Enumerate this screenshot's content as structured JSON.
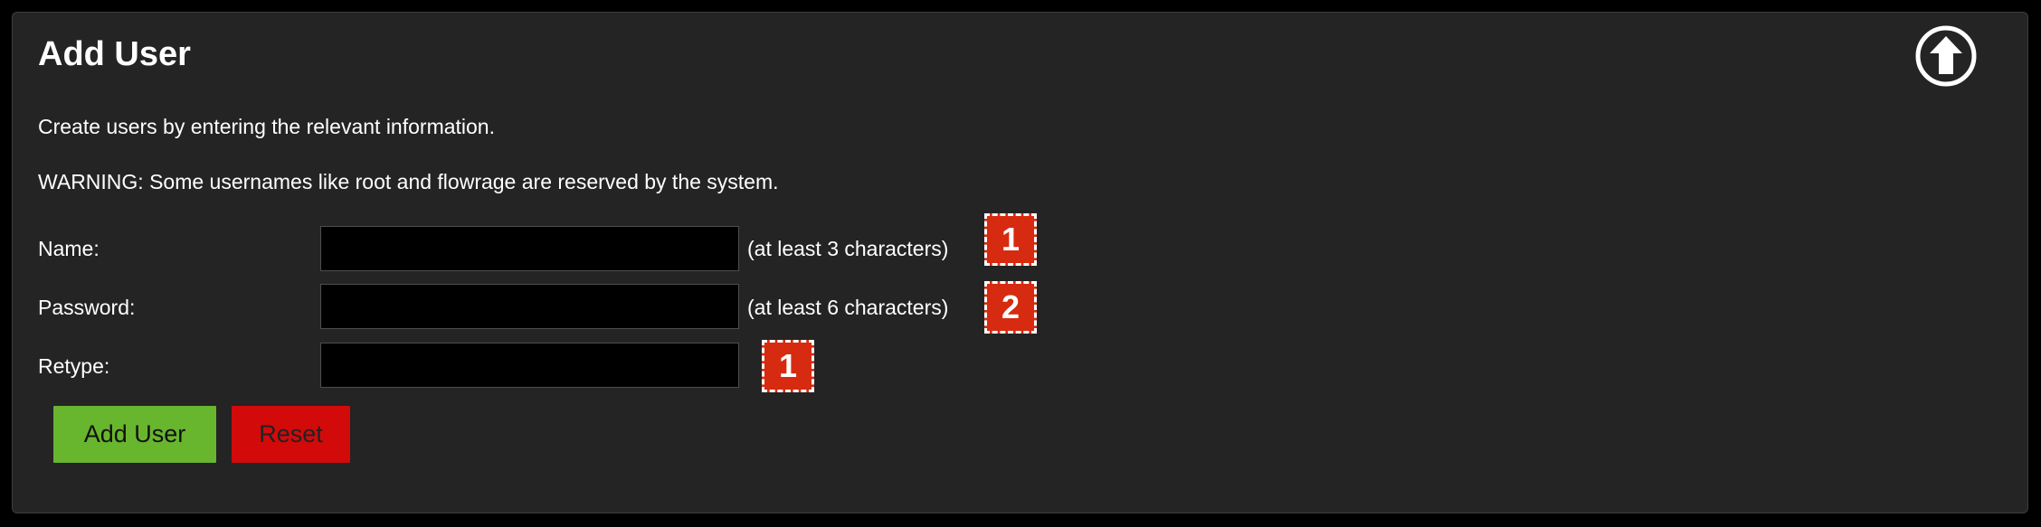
{
  "panel": {
    "title": "Add User",
    "description": "Create users by entering the relevant information.",
    "warning": "WARNING: Some usernames like root and flowrage are reserved by the system."
  },
  "fields": [
    {
      "label": "Name:",
      "value": "",
      "hint": "(at least 3 characters)",
      "badge": "1"
    },
    {
      "label": "Password:",
      "value": "",
      "hint": "(at least 6 characters)",
      "badge": "2"
    },
    {
      "label": "Retype:",
      "value": "",
      "hint": "",
      "badge": "1"
    }
  ],
  "buttons": {
    "add_label": "Add User",
    "reset_label": "Reset"
  },
  "icons": {
    "upload": "arrow-up-circle-icon"
  },
  "colors": {
    "panel_bg": "#242424",
    "add_button": "#68b52e",
    "reset_button": "#d30a0a",
    "badge": "#d62b10"
  }
}
